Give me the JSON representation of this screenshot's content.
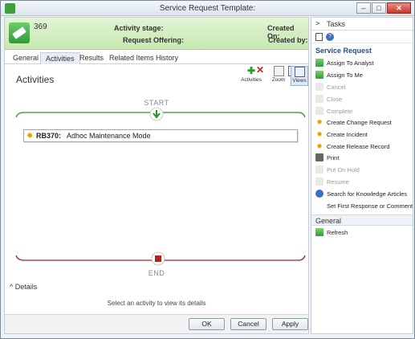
{
  "window": {
    "title": "Service Request Template:",
    "minimize": "–",
    "maximize": "□",
    "close": "✕"
  },
  "header": {
    "id": "369",
    "activity_stage_label": "Activity stage:",
    "request_offering_label": "Request Offering:",
    "created_on_label": "Created On:",
    "created_by_label": "Created by:"
  },
  "tabs": [
    "General",
    "Activities",
    "Results",
    "Related Items",
    "History"
  ],
  "active_tab": "Activities",
  "content": {
    "title": "Activities",
    "start_label": "START",
    "end_label": "END",
    "activity": {
      "code": "RB370:",
      "name": "Adhoc Maintenance Mode"
    }
  },
  "toolbar": {
    "activities": "Activities",
    "zoom": "Zoom",
    "views": "Views"
  },
  "details": {
    "toggle": "Details",
    "message": "Select an activity to view its details"
  },
  "footer": {
    "ok": "OK",
    "cancel": "Cancel",
    "apply": "Apply"
  },
  "side": {
    "title": "Tasks",
    "section_title": "Service Request",
    "tasks": [
      {
        "label": "Assign To Analyst",
        "icon": "assign-icon",
        "enabled": true
      },
      {
        "label": "Assign To Me",
        "icon": "assign-icon",
        "enabled": true
      },
      {
        "label": "Cancel",
        "icon": "cancel-icon",
        "enabled": false
      },
      {
        "label": "Close",
        "icon": "close-icon",
        "enabled": false
      },
      {
        "label": "Complete",
        "icon": "complete-icon",
        "enabled": false
      },
      {
        "label": "Create Change Request",
        "icon": "sun-icon",
        "enabled": true
      },
      {
        "label": "Create Incident",
        "icon": "sun-icon",
        "enabled": true
      },
      {
        "label": "Create Release Record",
        "icon": "sun-icon",
        "enabled": true
      },
      {
        "label": "Print",
        "icon": "print-icon",
        "enabled": true
      },
      {
        "label": "Put On Hold",
        "icon": "hold-icon",
        "enabled": false
      },
      {
        "label": "Resume",
        "icon": "resume-icon",
        "enabled": false
      },
      {
        "label": "Search for Knowledge Articles",
        "icon": "search-icon",
        "enabled": true
      },
      {
        "label": "Set First Response or Comment",
        "icon": "",
        "enabled": true
      }
    ],
    "general_title": "General",
    "refresh": "Refresh"
  },
  "colors": {
    "header_green": "#c7e8b0",
    "start_green": "#3a8f2a",
    "end_red": "#b22222",
    "link_blue": "#1f4f8f"
  }
}
